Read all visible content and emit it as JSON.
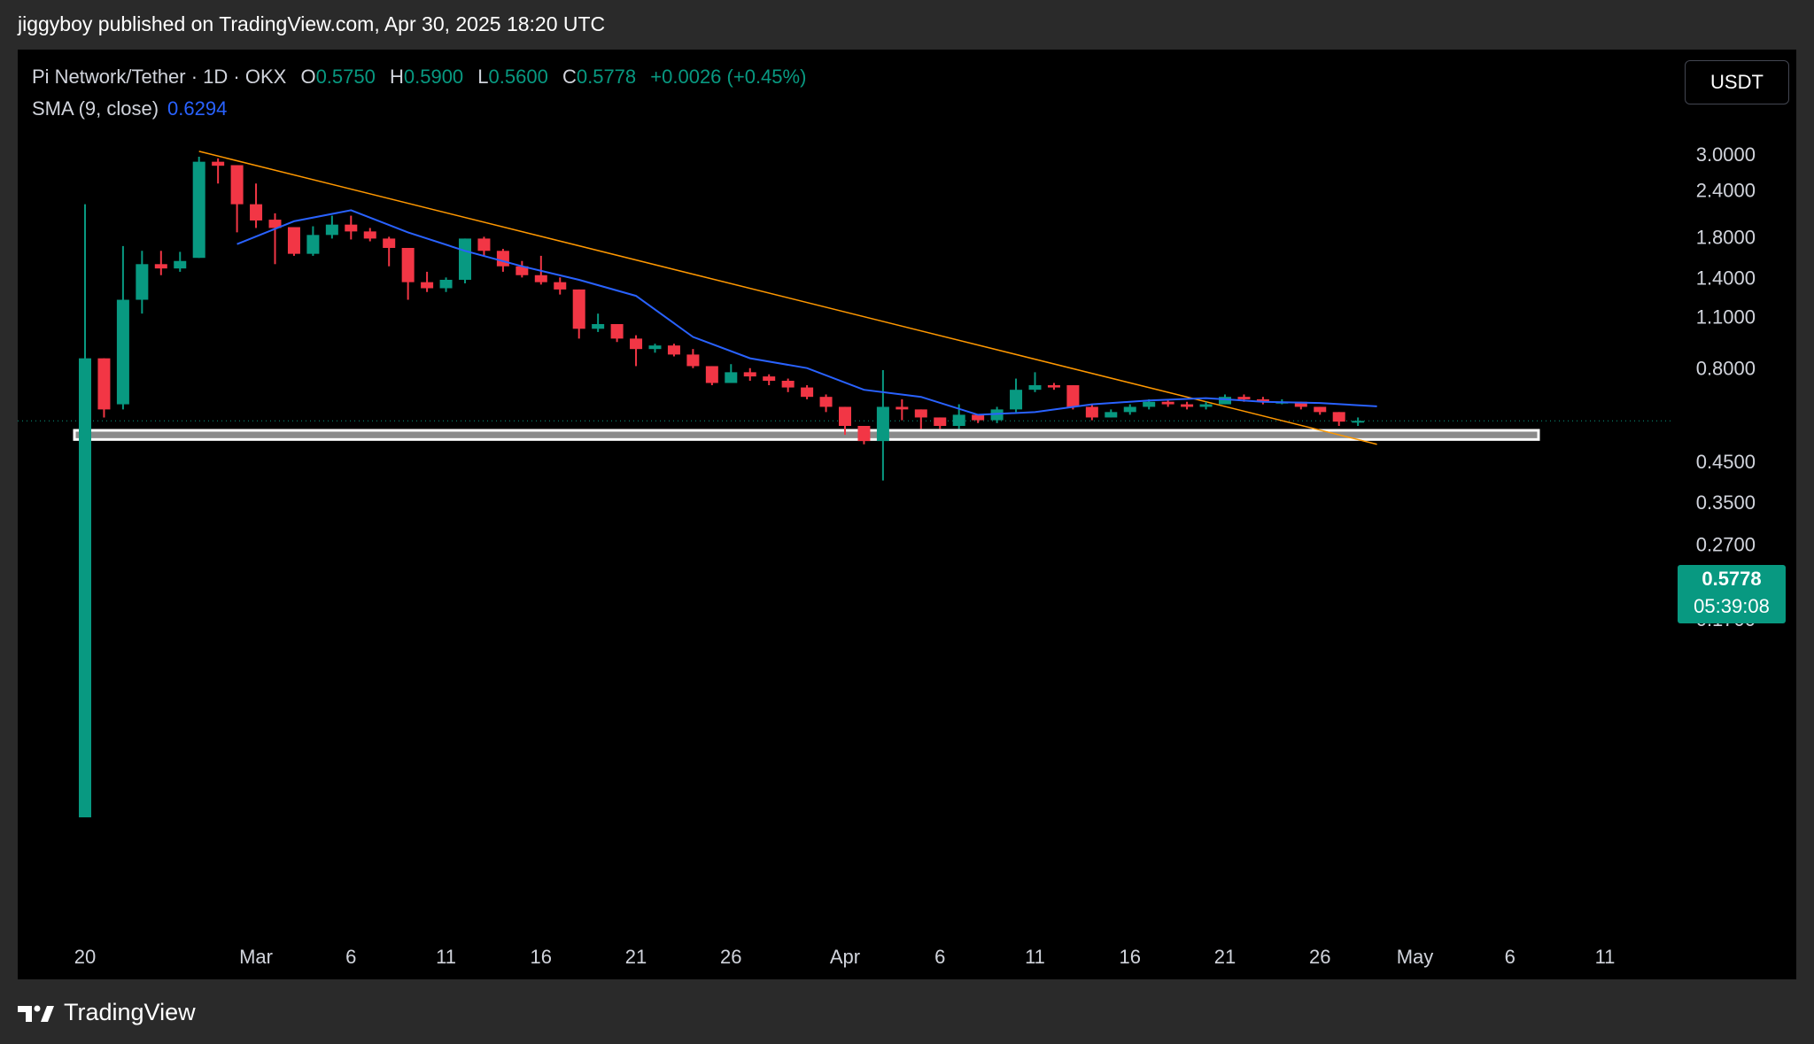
{
  "header": {
    "publish_line": "jiggyboy published on TradingView.com, Apr 30, 2025 18:20 UTC"
  },
  "legend": {
    "symbol": "Pi Network/Tether · 1D · OKX",
    "o_label": "O",
    "o_value": "0.5750",
    "h_label": "H",
    "h_value": "0.5900",
    "l_label": "L",
    "l_value": "0.5600",
    "c_label": "C",
    "c_value": "0.5778",
    "change": "+0.0026 (+0.45%)",
    "sma_label": "SMA (9, close)",
    "sma_value": "0.6294"
  },
  "currency_button": "USDT",
  "price_label": {
    "price": "0.5778",
    "countdown": "05:39:08"
  },
  "footer": {
    "brand": "TradingView"
  },
  "colors": {
    "up": "#089981",
    "down": "#f23645",
    "sma": "#2962ff",
    "trendline": "#ff9800",
    "background": "#000000"
  },
  "chart_data": {
    "type": "candlestick",
    "y_scale": "log",
    "y_ticks": [
      "3.0000",
      "2.4000",
      "1.8000",
      "1.4000",
      "1.1000",
      "0.8000",
      "0.4500",
      "0.3500",
      "0.2700",
      "0.2100",
      "0.1700"
    ],
    "x_ticks": [
      {
        "label": "20",
        "day": 0
      },
      {
        "label": "Mar",
        "day": 9
      },
      {
        "label": "6",
        "day": 14
      },
      {
        "label": "11",
        "day": 19
      },
      {
        "label": "16",
        "day": 24
      },
      {
        "label": "21",
        "day": 29
      },
      {
        "label": "26",
        "day": 34
      },
      {
        "label": "Apr",
        "day": 40
      },
      {
        "label": "6",
        "day": 45
      },
      {
        "label": "11",
        "day": 50
      },
      {
        "label": "16",
        "day": 55
      },
      {
        "label": "21",
        "day": 60
      },
      {
        "label": "26",
        "day": 65
      },
      {
        "label": "May",
        "day": 70
      },
      {
        "label": "6",
        "day": 75
      },
      {
        "label": "11",
        "day": 80
      }
    ],
    "ohlc": [
      [
        0.05,
        0.85,
        2.2,
        0.15,
        "2025-02-20"
      ],
      [
        0.85,
        0.62,
        0.85,
        0.59,
        "2025-02-21"
      ],
      [
        0.64,
        1.22,
        1.7,
        0.62,
        "2025-02-22"
      ],
      [
        1.22,
        1.52,
        1.65,
        1.12,
        "2025-02-23"
      ],
      [
        1.52,
        1.48,
        1.65,
        1.42,
        "2025-02-24"
      ],
      [
        1.48,
        1.55,
        1.64,
        1.45,
        "2025-02-25"
      ],
      [
        1.58,
        2.86,
        2.95,
        1.58,
        "2025-02-26"
      ],
      [
        2.86,
        2.79,
        2.92,
        2.5,
        "2025-02-27"
      ],
      [
        2.8,
        2.2,
        2.8,
        1.85,
        "2025-02-28"
      ],
      [
        2.2,
        1.99,
        2.5,
        1.9,
        "2025-03-01"
      ],
      [
        2.0,
        1.9,
        2.08,
        1.52,
        "2025-03-02"
      ],
      [
        1.91,
        1.62,
        1.91,
        1.6,
        "2025-03-03"
      ],
      [
        1.62,
        1.82,
        1.92,
        1.6,
        "2025-03-04"
      ],
      [
        1.82,
        1.94,
        2.05,
        1.78,
        "2025-03-05"
      ],
      [
        1.94,
        1.86,
        2.05,
        1.77,
        "2025-03-06"
      ],
      [
        1.86,
        1.78,
        1.9,
        1.75,
        "2025-03-07"
      ],
      [
        1.78,
        1.68,
        1.8,
        1.5,
        "2025-03-08"
      ],
      [
        1.68,
        1.36,
        1.68,
        1.22,
        "2025-03-09"
      ],
      [
        1.36,
        1.31,
        1.45,
        1.28,
        "2025-03-10"
      ],
      [
        1.31,
        1.38,
        1.4,
        1.28,
        "2025-03-11"
      ],
      [
        1.38,
        1.78,
        1.78,
        1.35,
        "2025-03-12"
      ],
      [
        1.78,
        1.65,
        1.8,
        1.6,
        "2025-03-13"
      ],
      [
        1.65,
        1.5,
        1.67,
        1.45,
        "2025-03-14"
      ],
      [
        1.5,
        1.42,
        1.55,
        1.4,
        "2025-03-15"
      ],
      [
        1.42,
        1.36,
        1.6,
        1.34,
        "2025-03-16"
      ],
      [
        1.36,
        1.3,
        1.4,
        1.26,
        "2025-03-17"
      ],
      [
        1.3,
        1.02,
        1.3,
        0.96,
        "2025-03-18"
      ],
      [
        1.02,
        1.05,
        1.12,
        1.0,
        "2025-03-19"
      ],
      [
        1.05,
        0.96,
        1.05,
        0.94,
        "2025-03-20"
      ],
      [
        0.96,
        0.9,
        0.98,
        0.81,
        "2025-03-21"
      ],
      [
        0.9,
        0.92,
        0.93,
        0.88,
        "2025-03-22"
      ],
      [
        0.92,
        0.87,
        0.93,
        0.86,
        "2025-03-23"
      ],
      [
        0.87,
        0.81,
        0.9,
        0.8,
        "2025-03-24"
      ],
      [
        0.81,
        0.73,
        0.81,
        0.72,
        "2025-03-25"
      ],
      [
        0.73,
        0.78,
        0.82,
        0.73,
        "2025-03-26"
      ],
      [
        0.78,
        0.76,
        0.8,
        0.74,
        "2025-03-27"
      ],
      [
        0.76,
        0.74,
        0.77,
        0.72,
        "2025-03-28"
      ],
      [
        0.74,
        0.71,
        0.75,
        0.69,
        "2025-03-29"
      ],
      [
        0.71,
        0.67,
        0.72,
        0.66,
        "2025-03-30"
      ],
      [
        0.67,
        0.63,
        0.68,
        0.61,
        "2025-03-31"
      ],
      [
        0.63,
        0.56,
        0.63,
        0.53,
        "2025-04-01"
      ],
      [
        0.56,
        0.51,
        0.56,
        0.5,
        "2025-04-02"
      ],
      [
        0.51,
        0.63,
        0.79,
        0.4,
        "2025-04-03"
      ],
      [
        0.63,
        0.62,
        0.66,
        0.58,
        "2025-04-04"
      ],
      [
        0.62,
        0.59,
        0.62,
        0.55,
        "2025-04-05"
      ],
      [
        0.59,
        0.56,
        0.59,
        0.55,
        "2025-04-06"
      ],
      [
        0.56,
        0.6,
        0.64,
        0.55,
        "2025-04-07"
      ],
      [
        0.6,
        0.58,
        0.6,
        0.57,
        "2025-04-08"
      ],
      [
        0.58,
        0.62,
        0.63,
        0.57,
        "2025-04-09"
      ],
      [
        0.62,
        0.7,
        0.75,
        0.61,
        "2025-04-10"
      ],
      [
        0.7,
        0.72,
        0.78,
        0.69,
        "2025-04-11"
      ],
      [
        0.72,
        0.71,
        0.73,
        0.7,
        "2025-04-12"
      ],
      [
        0.72,
        0.63,
        0.72,
        0.62,
        "2025-04-13"
      ],
      [
        0.63,
        0.59,
        0.64,
        0.58,
        "2025-04-14"
      ],
      [
        0.59,
        0.61,
        0.62,
        0.59,
        "2025-04-15"
      ],
      [
        0.61,
        0.63,
        0.64,
        0.6,
        "2025-04-16"
      ],
      [
        0.63,
        0.65,
        0.66,
        0.62,
        "2025-04-17"
      ],
      [
        0.65,
        0.64,
        0.66,
        0.63,
        "2025-04-18"
      ],
      [
        0.64,
        0.63,
        0.65,
        0.62,
        "2025-04-19"
      ],
      [
        0.63,
        0.64,
        0.65,
        0.62,
        "2025-04-20"
      ],
      [
        0.64,
        0.67,
        0.68,
        0.64,
        "2025-04-21"
      ],
      [
        0.67,
        0.66,
        0.68,
        0.65,
        "2025-04-22"
      ],
      [
        0.66,
        0.65,
        0.67,
        0.64,
        "2025-04-23"
      ],
      [
        0.65,
        0.65,
        0.66,
        0.64,
        "2025-04-24"
      ],
      [
        0.65,
        0.63,
        0.65,
        0.62,
        "2025-04-25"
      ],
      [
        0.63,
        0.61,
        0.63,
        0.6,
        "2025-04-26"
      ],
      [
        0.61,
        0.575,
        0.61,
        0.56,
        "2025-04-27"
      ],
      [
        0.575,
        0.5778,
        0.59,
        0.56,
        "2025-04-28"
      ]
    ],
    "sma": {
      "name": "SMA (9, close)",
      "points": [
        [
          8,
          1.72
        ],
        [
          11,
          1.98
        ],
        [
          14,
          2.12
        ],
        [
          17,
          1.85
        ],
        [
          20,
          1.65
        ],
        [
          23,
          1.5
        ],
        [
          26,
          1.38
        ],
        [
          29,
          1.25
        ],
        [
          32,
          0.97
        ],
        [
          35,
          0.85
        ],
        [
          38,
          0.8
        ],
        [
          41,
          0.7
        ],
        [
          44,
          0.67
        ],
        [
          47,
          0.6
        ],
        [
          50,
          0.61
        ],
        [
          53,
          0.64
        ],
        [
          56,
          0.655
        ],
        [
          59,
          0.665
        ],
        [
          62,
          0.65
        ],
        [
          65,
          0.645
        ],
        [
          68,
          0.632
        ]
      ]
    },
    "trendline": {
      "from": [
        6,
        3.05
      ],
      "to": [
        68,
        0.5
      ]
    },
    "support_zone": {
      "from": 0.545,
      "to": 0.515
    },
    "last_price": 0.5778
  }
}
